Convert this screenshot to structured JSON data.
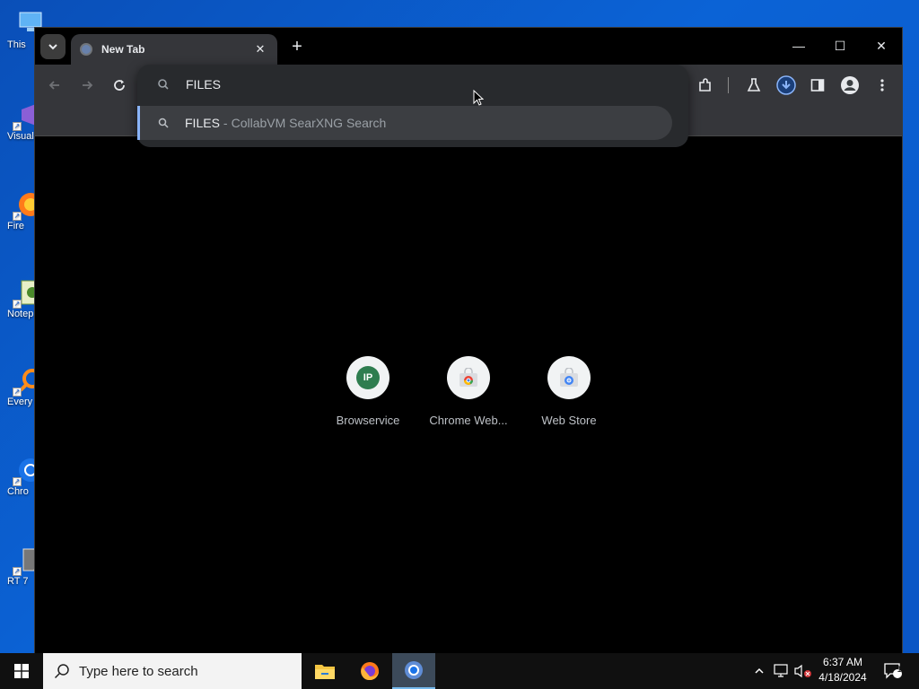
{
  "desktop": {
    "icons": [
      {
        "label": "This"
      },
      {
        "label": "Visual"
      },
      {
        "label": "Fire"
      },
      {
        "label": "Notep"
      },
      {
        "label": "Every"
      },
      {
        "label": "Chro"
      },
      {
        "label": "RT 7"
      }
    ]
  },
  "browser": {
    "tab": {
      "title": "New Tab",
      "close_glyph": "✕"
    },
    "new_tab_glyph": "+",
    "window_controls": {
      "minimize": "—",
      "maximize": "☐",
      "close": "✕"
    },
    "omnibox": {
      "input_text": "FILES",
      "suggestion": {
        "query": "FILES",
        "separator": "-",
        "engine": "CollabVM SearXNG Search"
      }
    },
    "shortcuts": [
      {
        "label": "Browservice",
        "badge": "IP"
      },
      {
        "label": "Chrome Web...",
        "badge": ""
      },
      {
        "label": "Web Store",
        "badge": ""
      }
    ],
    "colors": {
      "accent": "#8ab4f8",
      "toolbar": "#35363a",
      "page_bg": "#000000"
    }
  },
  "taskbar": {
    "search_placeholder": "Type here to search",
    "clock_time": "6:37 AM",
    "clock_date": "4/18/2024",
    "notification_count": "1"
  }
}
